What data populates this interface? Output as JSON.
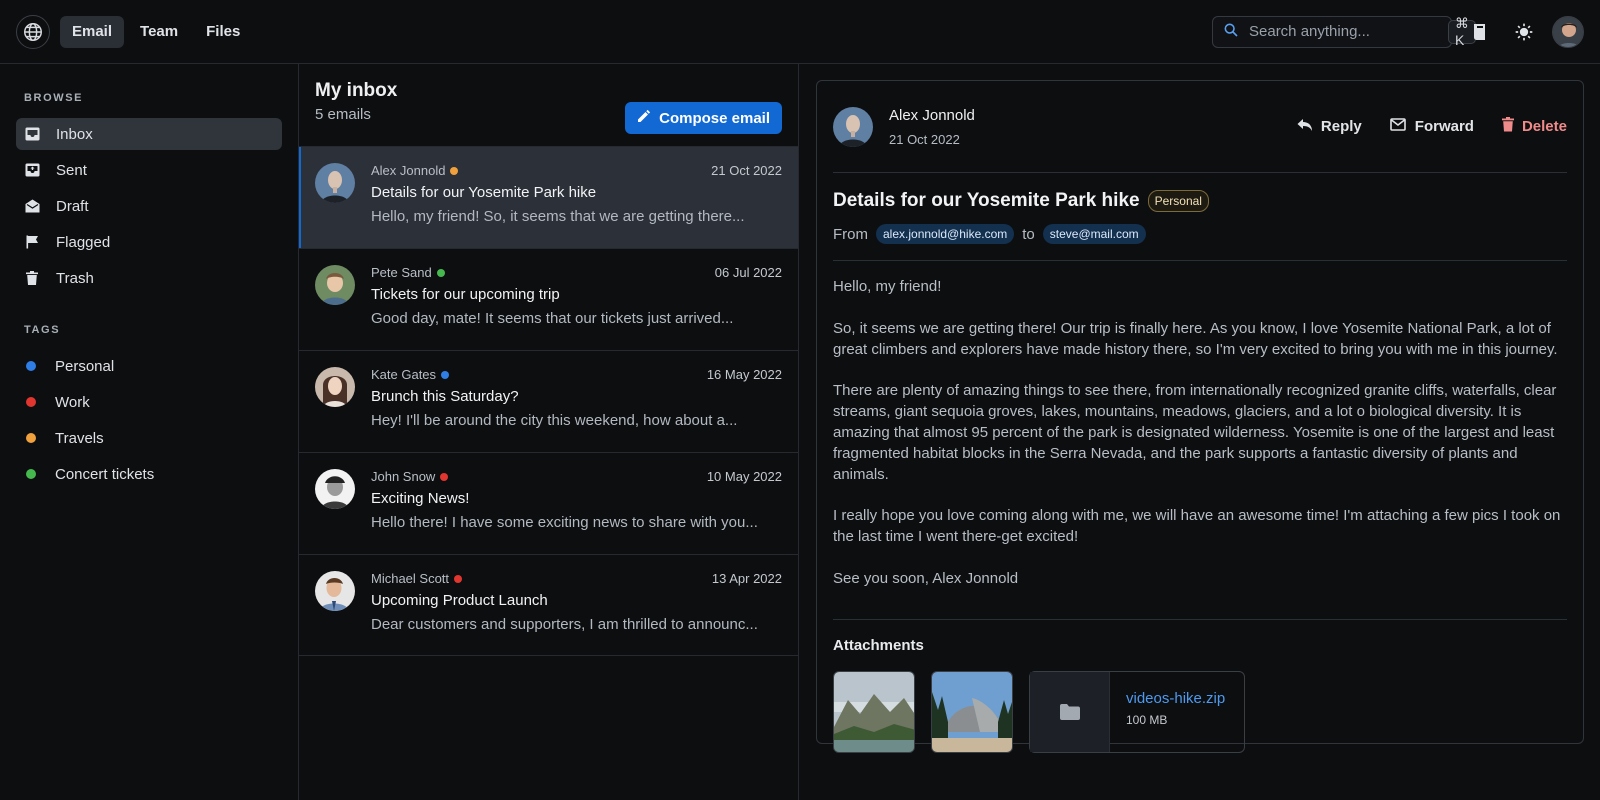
{
  "topnav": {
    "items": [
      {
        "label": "Email",
        "active": true
      },
      {
        "label": "Team",
        "active": false
      },
      {
        "label": "Files",
        "active": false
      }
    ],
    "search_placeholder": "Search anything...",
    "shortcut": "⌘ K"
  },
  "sidebar": {
    "browse_title": "BROWSE",
    "browse": [
      {
        "label": "Inbox",
        "icon": "inbox-icon",
        "active": true
      },
      {
        "label": "Sent",
        "icon": "sent-icon",
        "active": false
      },
      {
        "label": "Draft",
        "icon": "draft-icon",
        "active": false
      },
      {
        "label": "Flagged",
        "icon": "flag-icon",
        "active": false
      },
      {
        "label": "Trash",
        "icon": "trash-icon",
        "active": false
      }
    ],
    "tags_title": "TAGS",
    "tags": [
      {
        "label": "Personal",
        "color": "#2f7ee6"
      },
      {
        "label": "Work",
        "color": "#e0362f"
      },
      {
        "label": "Travels",
        "color": "#f0a03c"
      },
      {
        "label": "Concert tickets",
        "color": "#45b94e"
      }
    ]
  },
  "inbox": {
    "title": "My inbox",
    "count": "5 emails",
    "compose_label": "Compose email",
    "emails": [
      {
        "sender": "Alex Jonnold",
        "dot": "#f0a03c",
        "date": "21 Oct 2022",
        "subject": "Details for our Yosemite Park hike",
        "preview": "Hello, my friend! So, it seems that we are getting there..."
      },
      {
        "sender": "Pete Sand",
        "dot": "#45b94e",
        "date": "06 Jul 2022",
        "subject": "Tickets for our upcoming trip",
        "preview": "Good day, mate! It seems that our tickets just arrived..."
      },
      {
        "sender": "Kate Gates",
        "dot": "#2f7ee6",
        "date": "16 May 2022",
        "subject": "Brunch this Saturday?",
        "preview": "Hey! I'll be around the city this weekend, how about a..."
      },
      {
        "sender": "John Snow",
        "dot": "#e0362f",
        "date": "10 May 2022",
        "subject": "Exciting News!",
        "preview": "Hello there! I have some exciting news to share with you..."
      },
      {
        "sender": "Michael Scott",
        "dot": "#e0362f",
        "date": "13 Apr 2022",
        "subject": "Upcoming Product Launch",
        "preview": "Dear customers and supporters, I am thrilled to announc..."
      }
    ]
  },
  "reader": {
    "sender": "Alex Jonnold",
    "date": "21 Oct 2022",
    "actions": {
      "reply": "Reply",
      "forward": "Forward",
      "delete": "Delete"
    },
    "subject": "Details for our Yosemite Park hike",
    "tag": "Personal",
    "from_label": "From",
    "from_email": "alex.jonnold@hike.com",
    "to_label": "to",
    "to_email": "steve@mail.com",
    "paragraphs": [
      "Hello, my friend!",
      "So, it seems we are getting there! Our trip is finally here. As you know, I love Yosemite National Park, a lot of great climbers and explorers have made history there, so I'm very excited to bring you with me in this journey.",
      "There are plenty of amazing things to see there, from internationally recognized granite cliffs, waterfalls, clear streams, giant sequoia groves, lakes, mountains, meadows, glaciers, and a lot o biological diversity. It is amazing that almost 95 percent of the park is designated wilderness. Yosemite is one of the largest and least fragmented habitat blocks in the Serra Nevada, and the park supports a fantastic diversity of plants and animals.",
      "I really hope you love coming along with me, we will have an awesome time! I'm attaching a few pics I took on the last time I went there-get excited!",
      "See you soon, Alex Jonnold"
    ],
    "attachments_title": "Attachments",
    "file": {
      "name": "videos-hike.zip",
      "size": "100 MB"
    }
  }
}
